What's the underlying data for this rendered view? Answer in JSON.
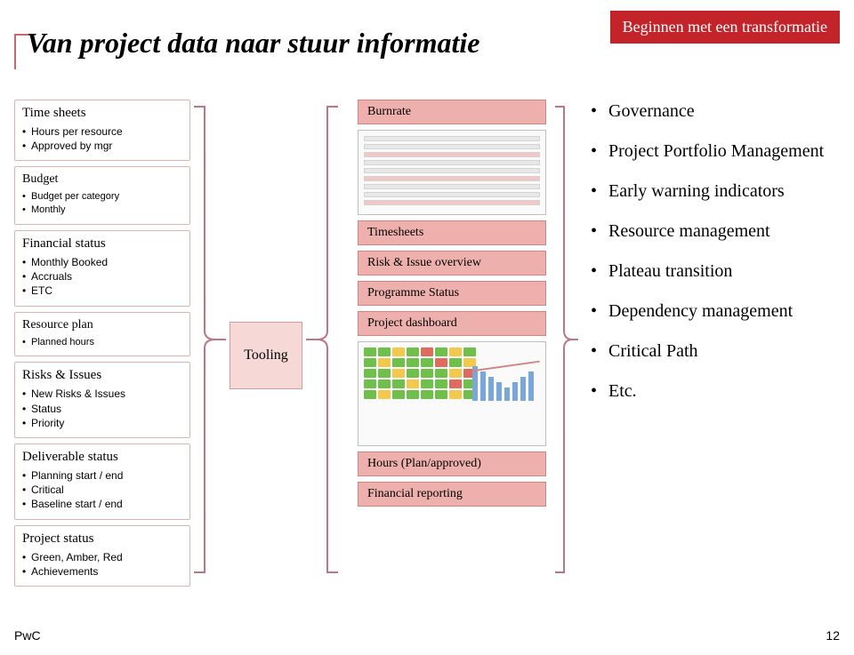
{
  "corner_tag": "Beginnen met een transformatie",
  "title": "Van project data naar stuur informatie",
  "inputs": [
    {
      "h": "Time sheets",
      "items": [
        "Hours per resource",
        "Approved by mgr"
      ],
      "small": false
    },
    {
      "h": "Budget",
      "items": [
        "Budget per category",
        "Monthly"
      ],
      "small": true
    },
    {
      "h": "Financial status",
      "items": [
        "Monthly Booked",
        "Accruals",
        "ETC"
      ],
      "small": false
    },
    {
      "h": "Resource plan",
      "items": [
        "Planned hours"
      ],
      "small": true
    },
    {
      "h": "Risks & Issues",
      "items": [
        "New Risks & Issues",
        "Status",
        "Priority"
      ],
      "small": false
    },
    {
      "h": "Deliverable status",
      "items": [
        "Planning start / end",
        "Critical",
        "Baseline start / end"
      ],
      "small": false
    },
    {
      "h": "Project status",
      "items": [
        "Green, Amber, Red",
        "Achievements"
      ],
      "small": false
    }
  ],
  "tooling_label": "Tooling",
  "chips": [
    "Burnrate",
    "__thumb1",
    "Timesheets",
    "Risk & Issue overview",
    "Programme Status",
    "Project dashboard",
    "__thumb2",
    "Hours (Plan/approved)",
    "Financial reporting"
  ],
  "outputs": [
    "Governance",
    "Project Portfolio Management",
    "Early warning indicators",
    "Resource management",
    "Plateau transition",
    "Dependency management",
    "Critical Path",
    "Etc."
  ],
  "footer_left": "PwC",
  "footer_right": "12"
}
